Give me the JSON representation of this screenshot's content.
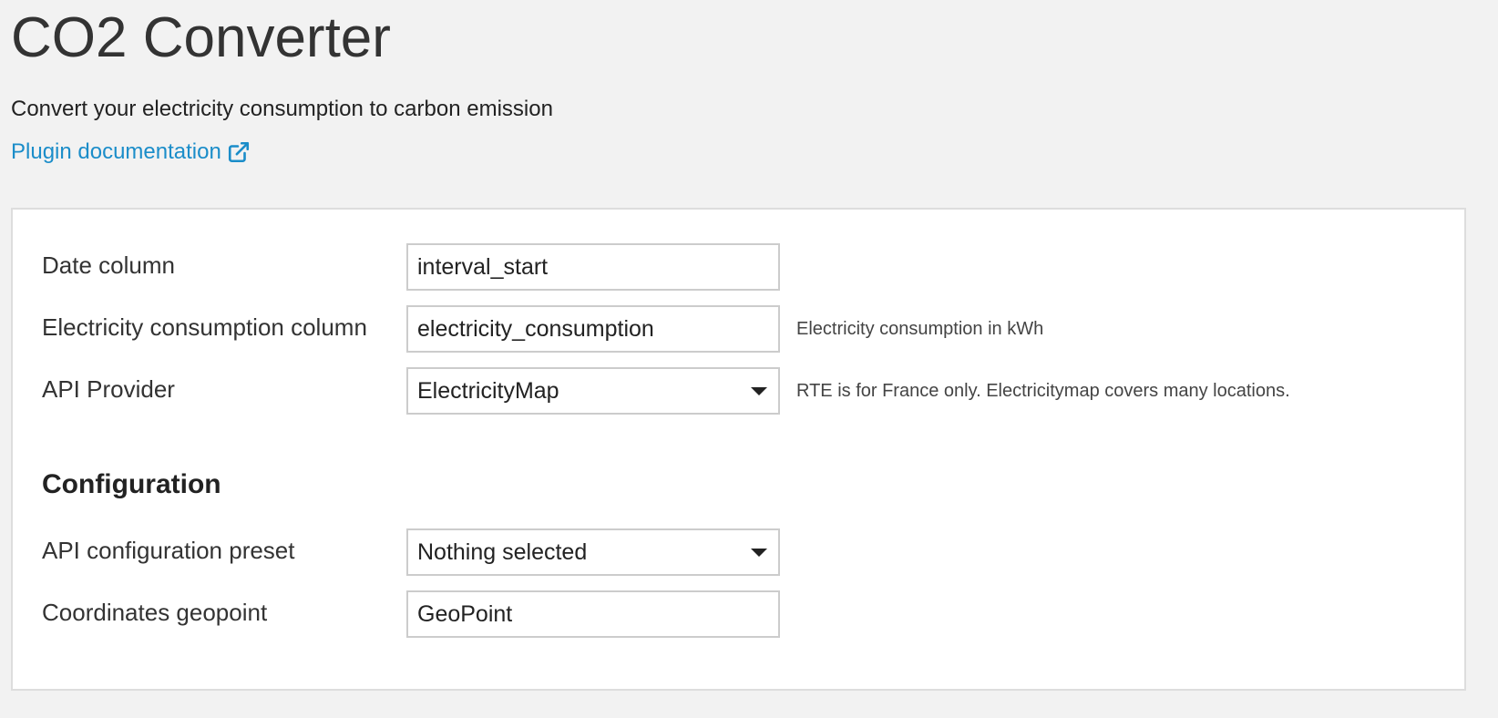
{
  "header": {
    "title": "CO2 Converter",
    "subtitle": "Convert your electricity consumption to carbon emission",
    "doc_link": "Plugin documentation",
    "doc_link_icon": "external-link-icon"
  },
  "form": {
    "date_column": {
      "label": "Date column",
      "value": "interval_start"
    },
    "consumption_column": {
      "label": "Electricity consumption column",
      "value": "electricity_consumption",
      "help": "Electricity consumption in kWh"
    },
    "api_provider": {
      "label": "API Provider",
      "value": "ElectricityMap",
      "help": "RTE is for France only. Electricitymap covers many locations."
    },
    "configuration": {
      "heading": "Configuration",
      "preset": {
        "label": "API configuration preset",
        "value": "Nothing selected"
      },
      "geopoint": {
        "label": "Coordinates geopoint",
        "value": "GeoPoint"
      }
    }
  },
  "colors": {
    "background": "#f2f2f2",
    "panel": "#ffffff",
    "link": "#1b8dc9",
    "text": "#333333"
  }
}
